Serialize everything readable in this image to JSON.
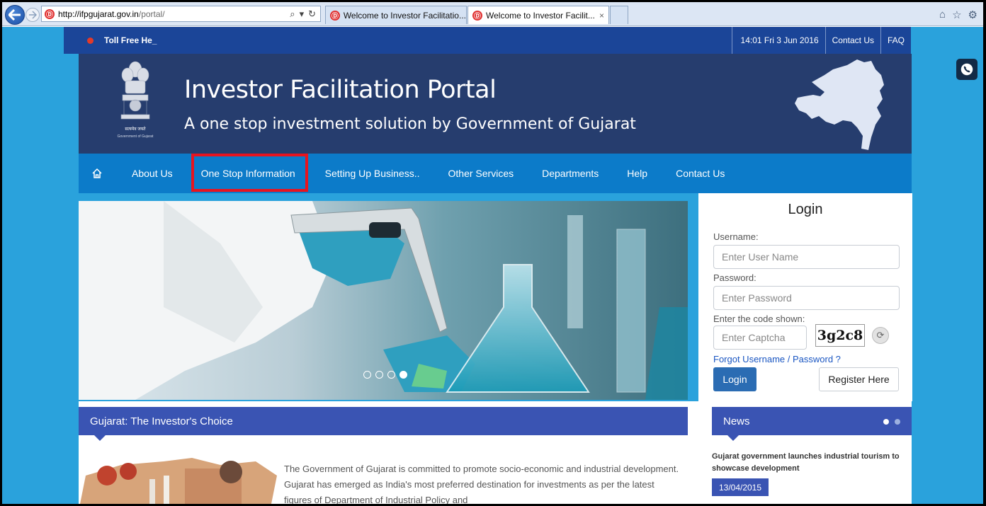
{
  "browser": {
    "url_host": "http://ifpgujarat.gov.in",
    "url_path": "/portal/",
    "favicon": "Ⓓ",
    "tabs": [
      {
        "title": "Welcome to Investor Facilitatio...",
        "active": false
      },
      {
        "title": "Welcome to Investor Facilit...",
        "active": true,
        "close": "×"
      }
    ]
  },
  "topbar": {
    "tollfree": "Toll Free He_",
    "datetime": "14:01 Fri 3 Jun 2016",
    "contact": "Contact Us",
    "faq": "FAQ"
  },
  "banner": {
    "title": "Investor Facilitation Portal",
    "subtitle": "A one stop investment solution by Government of Gujarat",
    "emblem_motto": "सत्यमेव जयते",
    "emblem_caption": "Government of Gujarat"
  },
  "nav": {
    "items": [
      "About Us",
      "One Stop Information",
      "Setting Up Business..",
      "Other Services",
      "Departments",
      "Help",
      "Contact Us"
    ],
    "highlighted": "One Stop Information"
  },
  "slider": {
    "dots": 4,
    "active_dot": 4
  },
  "login": {
    "title": "Login",
    "username_label": "Username:",
    "username_placeholder": "Enter User Name",
    "password_label": "Password:",
    "password_placeholder": "Enter Password",
    "code_label": "Enter the code shown:",
    "captcha_placeholder": "Enter Captcha",
    "captcha_code": "3g2c8",
    "forgot": "Forgot Username / Password ?",
    "login_button": "Login",
    "register_button": "Register Here"
  },
  "section": {
    "heading": "Gujarat: The Investor's Choice",
    "paragraph": "The Government of Gujarat is committed to promote socio-economic and industrial development. Gujarat has emerged as India's most preferred destination for investments as per the latest figures of Department of Industrial Policy and"
  },
  "news": {
    "heading": "News",
    "item_title": "Gujarat government launches industrial tourism to showcase development",
    "item_date": "13/04/2015"
  },
  "colors": {
    "page_bg": "#2aa2dc",
    "topbar": "#1b4598",
    "banner": "#263d6e",
    "navbar": "#0c7bc9",
    "section_bar": "#3a54b3",
    "highlight": "#e8141e"
  }
}
